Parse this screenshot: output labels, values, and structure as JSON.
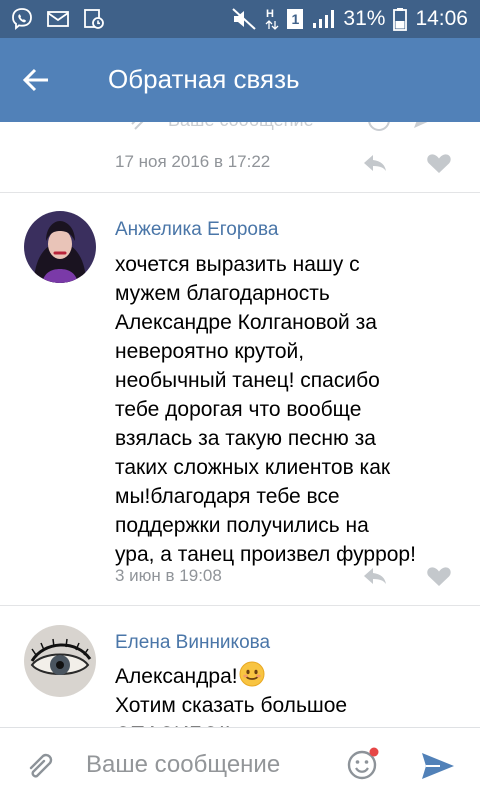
{
  "status_bar": {
    "battery": "31%",
    "time": "14:06",
    "sim": "1",
    "network": "H"
  },
  "header": {
    "title": "Обратная связь"
  },
  "previous_comment": {
    "ghost_text": "Ваше сообщение",
    "date": "17 ноя 2016 в 17:22"
  },
  "comments": [
    {
      "author": "Анжелика Егорова",
      "text": "хочется выразить нашу с\nмужем благодарность\nАлександре Колгановой за\nневероятно крутой,\nнеобычный танец! спасибо\nтебе дорогая что вообще\nвзялась за такую песню за\nтаких сложных клиентов как\nмы!благодаря тебе все\nподдержки получились на\nура, а танец произвел фуррор!",
      "date": "3 июн в 19:08"
    },
    {
      "author": "Елена Винникова",
      "text_line1": "Александра!",
      "emoji": "😊",
      "text_rest": "Хотим сказать большое\nСПАСИБО!!"
    }
  ],
  "composer": {
    "placeholder": "Ваше сообщение"
  },
  "colors": {
    "status_bar": "#3f6189",
    "app_bar": "#5181b8",
    "link": "#4a76a8",
    "meta": "#909499",
    "icon": "#c4c8cc",
    "send": "#5181b8"
  }
}
